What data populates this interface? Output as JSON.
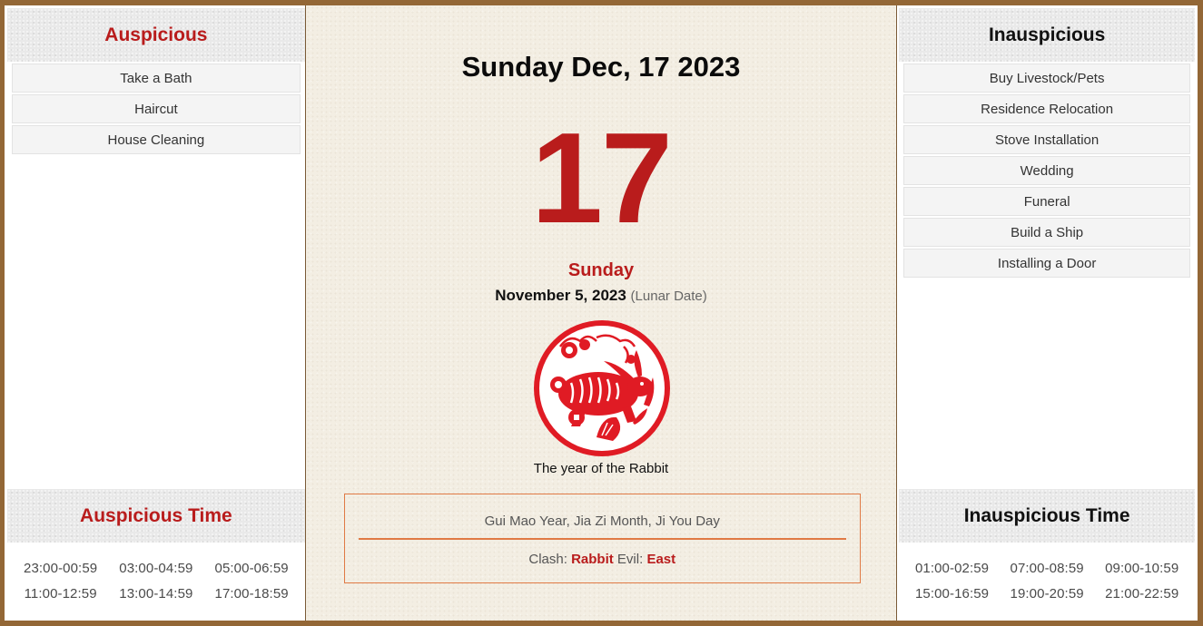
{
  "colors": {
    "accent_red": "#b91c1c",
    "frame_brown": "#936736",
    "parchment": "#f3eee3",
    "info_border": "#e07a45"
  },
  "auspicious": {
    "title": "Auspicious",
    "items": [
      "Take a Bath",
      "Haircut",
      "House Cleaning"
    ]
  },
  "inauspicious": {
    "title": "Inauspicious",
    "items": [
      "Buy Livestock/Pets",
      "Residence Relocation",
      "Stove Installation",
      "Wedding",
      "Funeral",
      "Build a Ship",
      "Installing a Door"
    ]
  },
  "auspicious_time": {
    "title": "Auspicious Time",
    "slots": [
      "23:00-00:59",
      "03:00-04:59",
      "05:00-06:59",
      "11:00-12:59",
      "13:00-14:59",
      "17:00-18:59"
    ]
  },
  "inauspicious_time": {
    "title": "Inauspicious Time",
    "slots": [
      "01:00-02:59",
      "07:00-08:59",
      "09:00-10:59",
      "15:00-16:59",
      "19:00-20:59",
      "21:00-22:59"
    ]
  },
  "calendar": {
    "date_title": "Sunday Dec, 17 2023",
    "day_number": "17",
    "weekday": "Sunday",
    "lunar_date": "November 5, 2023",
    "lunar_note": "(Lunar Date)",
    "zodiac_icon": "rabbit-papercut-icon",
    "zodiac_caption": "The year of the Rabbit",
    "ganzhi": "Gui Mao Year, Jia Zi Month, Ji You Day",
    "clash_label": "Clash:",
    "clash_value": "Rabbit",
    "evil_label": "Evil:",
    "evil_value": "East"
  }
}
